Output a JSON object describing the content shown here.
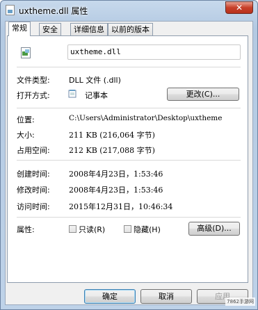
{
  "window": {
    "title": "uxtheme.dll 属性",
    "close_label": "✕"
  },
  "tabs": [
    {
      "label": "常规",
      "active": true
    },
    {
      "label": "安全",
      "active": false
    },
    {
      "label": "详细信息",
      "active": false
    },
    {
      "label": "以前的版本",
      "active": false
    }
  ],
  "file": {
    "name": "uxtheme.dll",
    "icon": "dll-file-icon"
  },
  "details": {
    "file_type_label": "文件类型:",
    "file_type_value": "DLL 文件 (.dll)",
    "open_with_label": "打开方式:",
    "open_with_value": "记事本",
    "open_with_icon": "notepad-icon",
    "change_button": "更改(C)...",
    "location_label": "位置:",
    "location_value": "C:\\Users\\Administrator\\Desktop\\uxtheme",
    "size_label": "大小:",
    "size_value": "211 KB (216,064 字节)",
    "disk_size_label": "占用空间:",
    "disk_size_value": "212 KB (217,088 字节)",
    "created_label": "创建时间:",
    "created_value": "2008年4月23日，1:53:46",
    "modified_label": "修改时间:",
    "modified_value": "2008年4月23日，1:53:46",
    "accessed_label": "访问时间:",
    "accessed_value": "2015年12月31日，10:46:34",
    "attributes_label": "属性:",
    "readonly_label": "只读(R)",
    "hidden_label": "隐藏(H)",
    "advanced_button": "高级(D)..."
  },
  "footer": {
    "ok": "确定",
    "cancel": "取消",
    "apply": "应用"
  },
  "watermark": "7862手游网",
  "colors": {
    "title_bg": "#bed2e8",
    "close_red": "#c7402a",
    "default_border": "#3c7fb1"
  }
}
